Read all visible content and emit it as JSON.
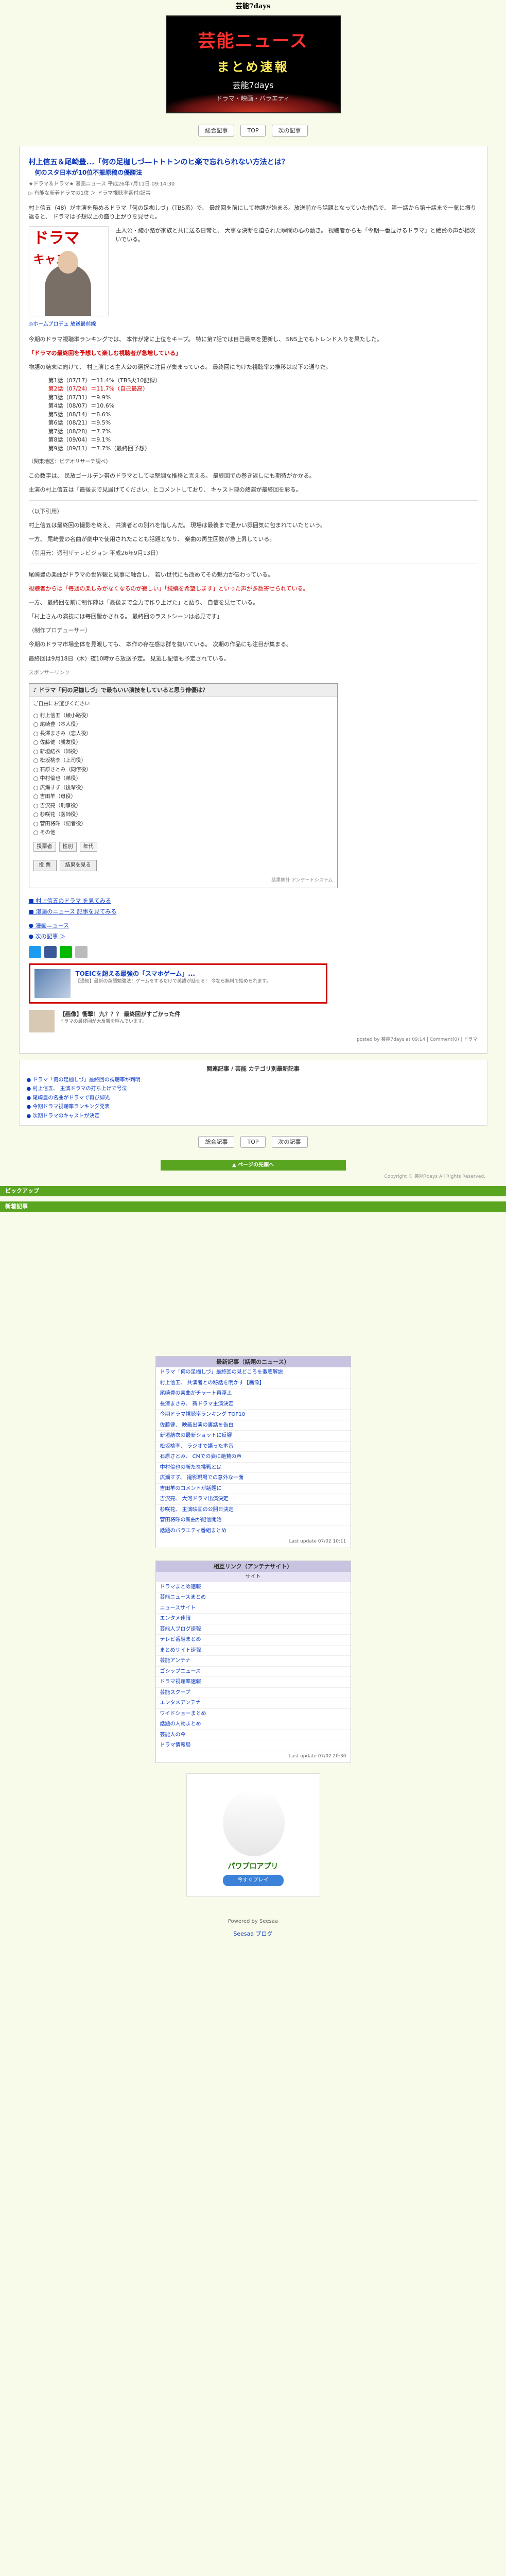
{
  "header": {
    "site_title": "芸能7days"
  },
  "banner": {
    "line1": "芸能ニュース",
    "line2": "まとめ速報",
    "line3": "芸能7days",
    "line4": "ドラマ・映画・バラエティ"
  },
  "nav": {
    "items": [
      "総合記事",
      "TOP",
      "次の記事"
    ]
  },
  "article": {
    "title": "村上信五＆尾崎豊...「何の足枷しづ―トトトンのヒ楽で忘れられない方法とは？",
    "subtitle": "何のスタ日本が10位不振原稿の優勝法",
    "meta": "★ドラマ＆ドラマ★ 漫画ニュース 平成26年7月11日 09:14:30",
    "meta2": "▷ 有能な新着ドラマの1位 ＞ ドラマ視聴率番付/記事",
    "p1": "村上信五（48）が主演を務めるドラマ「何の足枷しづ」（TBS系）で、 最終回を前にして物語が始まる。放送前から話題となっていた作品で、 第一話から第十話まで一気に振り返ると、 ドラマは予想以上の盛り上がりを見せた。",
    "p2": "主人公・綾小路が家族と共に送る日常と、 大事な決断を迫られた瞬間の心の動き。 視聴者からも「今期一番泣けるドラマ」と絶賛の声が相次いでいる。",
    "pic": {
      "t1": "ドラマ",
      "t2": "キャスト"
    },
    "cap": "◎ホームプロデュ 放送最前線",
    "p3": "今期のドラマ視聴率ランキングでは、 本作が常に上位をキープ。 特に第7話では自己最高を更新し、 SNS上でもトレンド入りを果たした。",
    "highlight": "「ドラマの最終回を予想して楽しむ視聴者が急増している」",
    "p4": "物語の結末に向けて、 村上演じる主人公の選択に注目が集まっている。 最終回に向けた視聴率の推移は以下の通りだ。",
    "ratings": [
      "第1話（07/17）＝11.4%（TBS火10記録）",
      "第2話（07/24）＝11.7%（自己最高）",
      "第3話（07/31）＝9.9%",
      "第4話（08/07）＝10.6%",
      "第5話（08/14）＝8.6%",
      "第6話（08/21）＝9.5%",
      "第7話（08/28）＝7.7%",
      "第8話（09/04）＝9.1%",
      "第9話（09/11）＝7.7%（最終回予想）"
    ],
    "src": "（関東地区：ビデオリサーチ調べ）",
    "p5": "この数字は、 民放ゴールデン帯のドラマとしては堅調な推移と言える。 最終回での巻き返しにも期待がかかる。",
    "p6": "主演の村上信五は「最後まで見届けてください」とコメントしており、 キャスト陣の熱演が最終回を彩る。",
    "quote_label": "（以下引用）",
    "p7": "村上信五は最終回の撮影を終え、 共演者との別れを惜しんだ。 現場は最後まで温かい雰囲気に包まれていたという。",
    "p8": "一方、 尾崎豊の名曲が劇中で使用されたことも話題となり、 楽曲の再生回数が急上昇している。",
    "quote_src": "（引用元：週刊ザテレビジョン 平成26年9月13日）",
    "p9": "尾崎豊の楽曲がドラマの世界観と見事に融合し、 若い世代にも改めてその魅力が伝わっている。",
    "p10": "視聴者からは「毎週の楽しみがなくなるのが寂しい」「続編を希望します」といった声が多数寄せられている。",
    "p11": "一方、 最終回を前に制作陣は「最後まで全力で作り上げた」と語り、 自信を見せている。",
    "quote2": "「村上さんの演技には毎回驚かされる。 最終回のラストシーンは必見です」",
    "quote2_name": "（制作プロデューサー）",
    "p12": "今期のドラマ市場全体を見渡しても、 本作の存在感は群を抜いている。 次期の作品にも注目が集まる。",
    "p13": "最終回は9月18日（木）夜10時から放送予定。 見逃し配信も予定されている。",
    "ad": "スポンサーリンク",
    "poll": {
      "header": "♪ ドラマ「何の足枷しづ」で最もいい演技をしていると思う俳優は？",
      "q": "ご自由にお選びください",
      "options": [
        "村上信五（綾小路役）",
        "尾崎豊（本人役）",
        "長澤まさみ（恋人役）",
        "佐藤健（親友役）",
        "新垣結衣（姉役）",
        "松坂桃李（上司役）",
        "石原さとみ（同僚役）",
        "中村倫也（弟役）",
        "広瀬すず（後輩役）",
        "吉田羊（母役）",
        "吉沢亮（刑事役）",
        "杉咲花（医師役）",
        "菅田将暉（記者役）",
        "その他"
      ],
      "form1": "投票者",
      "form2": "性別",
      "form3": "年代",
      "btn1": "投 票",
      "btn2": "結果を見る",
      "foot": "結果集計 アンケートシステム"
    },
    "links": [
      "■ 村上信五のドラマ を見てみる",
      "■ 漫画のニュース 記事を見てみる"
    ],
    "links2": [
      "● 漫画ニュース",
      "● 次の記事 ＞"
    ],
    "promo": {
      "title": "TOEICを超える最強の「スマホゲーム」...",
      "desc": "【通知】最新の英語勉強法！ゲームをするだけで英語が話せる！ 今なら無料で始められます。"
    },
    "promo2": {
      "title": "【画像】衝撃！九？？？ 最終回がすごかった件",
      "desc": "ドラマの最終回が大反響を呼んでいます。"
    },
    "foot": "posted by 芸能7days at 09:14 | Comment(0) | ドラマ"
  },
  "related": {
    "head": "関連記事 / 芸能 カテゴリ別最新記事",
    "items": [
      "● ドラマ「何の足枷しづ」最終回の視聴率が判明",
      "● 村上信五、 主演ドラマの打ち上げで号泣",
      "● 尾崎豊の名曲がドラマで再び脚光",
      "● 今期ドラマ視聴率ランキング発表",
      "● 次期ドラマのキャストが決定"
    ]
  },
  "footer": {
    "top": "▲ ページの先頭へ",
    "copy": "Copyright © 芸能7days All Rights Reserved.",
    "bar1": "ピックアップ",
    "bar2": "新着記事"
  },
  "side1": {
    "head": "最新記事（話題のニュース）",
    "items": [
      "ドラマ「何の足枷しづ」最終回の見どころを徹底解説",
      "村上信五、 共演者との秘話を明かす【画像】",
      "尾崎豊の楽曲がチャート再浮上",
      "長澤まさみ、 新ドラマ主演決定",
      "今期ドラマ視聴率ランキング TOP10",
      "佐藤健、 映画出演の裏話を告白",
      "新垣結衣の最新ショットに反響",
      "松坂桃李、 ラジオで語った本音",
      "石原さとみ、 CMでの姿に絶賛の声",
      "中村倫也の新たな挑戦とは",
      "広瀬すず、 撮影現場での意外な一面",
      "吉田羊のコメントが話題に",
      "吉沢亮、 大河ドラマ出演決定",
      "杉咲花、 主演映画の公開日決定",
      "菅田将暉の新曲が配信開始",
      "話題のバラエティ番組まとめ"
    ],
    "foot": "Last update 07/02 10:11"
  },
  "side2": {
    "head": "相互リンク（アンテナサイト）",
    "sub": "サイト",
    "items": [
      "ドラマまとめ速報",
      "芸能ニュースまとめ",
      "ニュースサイト",
      "エンタメ速報",
      "芸能人ブログ速報",
      "テレビ番組まとめ",
      "まとめサイト速報",
      "芸能アンテナ",
      "ゴシップニュース",
      "ドラマ視聴率速報",
      "芸能スクープ",
      "エンタメアンテナ",
      "ワイドショーまとめ",
      "話題の人物まとめ",
      "芸能人の今",
      "ドラマ情報局"
    ],
    "foot": "Last update 07/02 20:30"
  },
  "sponsor": {
    "title": "パワプロアプリ",
    "btn": "今すぐプレイ"
  },
  "bottom": {
    "powered": "Powered by Seesaa",
    "brand": "Seesaa ブログ"
  }
}
